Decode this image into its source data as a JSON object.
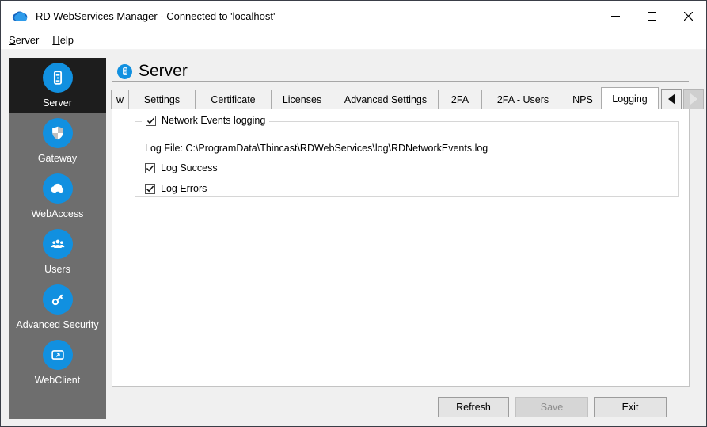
{
  "window": {
    "title": "RD WebServices Manager - Connected to 'localhost'"
  },
  "menu": {
    "items": [
      {
        "accel": "S",
        "rest": "erver"
      },
      {
        "accel": "H",
        "rest": "elp"
      }
    ]
  },
  "sidebar": {
    "accent_color": "#1190e0",
    "background_color": "#6e6e6e",
    "selected_color": "#1d1d1d",
    "items": [
      {
        "label": "Server",
        "icon": "server-icon",
        "selected": true
      },
      {
        "label": "Gateway",
        "icon": "shield-icon",
        "selected": false
      },
      {
        "label": "WebAccess",
        "icon": "cloud-icon",
        "selected": false
      },
      {
        "label": "Users",
        "icon": "users-icon",
        "selected": false
      },
      {
        "label": "Advanced Security",
        "icon": "key-icon",
        "selected": false
      },
      {
        "label": "WebClient",
        "icon": "screen-icon",
        "selected": false
      }
    ]
  },
  "header": {
    "title": "Server"
  },
  "tabs": {
    "items": [
      {
        "label": "w",
        "active": false
      },
      {
        "label": "Settings",
        "active": false
      },
      {
        "label": "Certificate",
        "active": false
      },
      {
        "label": "Licenses",
        "active": false
      },
      {
        "label": "Advanced Settings",
        "active": false
      },
      {
        "label": "2FA",
        "active": false
      },
      {
        "label": "2FA - Users",
        "active": false
      },
      {
        "label": "NPS",
        "active": false
      },
      {
        "label": "Logging",
        "active": true
      }
    ]
  },
  "logging": {
    "group_label": "Network Events logging",
    "group_checked": true,
    "log_file_line": "Log File: C:\\ProgramData\\Thincast\\RDWebServices\\log\\RDNetworkEvents.log",
    "checkboxes": [
      {
        "label": "Log Success",
        "checked": true
      },
      {
        "label": "Log Errors",
        "checked": true
      }
    ]
  },
  "footer": {
    "refresh": "Refresh",
    "save": "Save",
    "exit": "Exit"
  }
}
